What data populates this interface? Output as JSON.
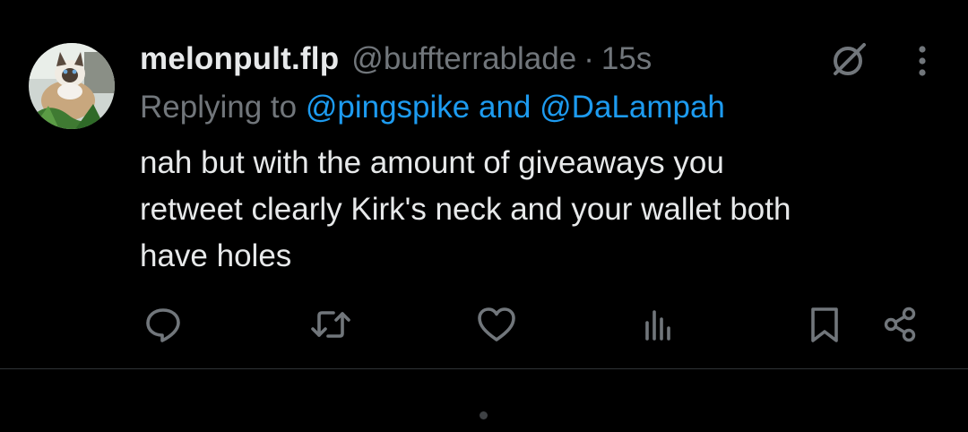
{
  "tweet": {
    "display_name": "melonpult.flp",
    "handle": "@buffterrablade",
    "separator": "·",
    "time": "15s",
    "reply": {
      "prefix": "Replying to",
      "mention1": "@pingspike",
      "conjunction": "and",
      "mention2": "@DaLampah"
    },
    "text_lines": [
      "nah but with the amount of giveaways you",
      "retweet clearly Kirk's neck and your wallet both",
      "have holes"
    ]
  },
  "icons": {
    "avatar": "cat-avatar",
    "grok": "grok-icon",
    "more": "more-vertical-icon",
    "actions": [
      "reply-icon",
      "retweet-icon",
      "like-icon",
      "views-icon",
      "bookmark-icon",
      "share-icon"
    ]
  },
  "colors": {
    "background": "#000000",
    "primary_text": "#e7e9ea",
    "secondary_text": "#71767b",
    "link": "#1d9bf0",
    "divider": "#2f3336"
  }
}
